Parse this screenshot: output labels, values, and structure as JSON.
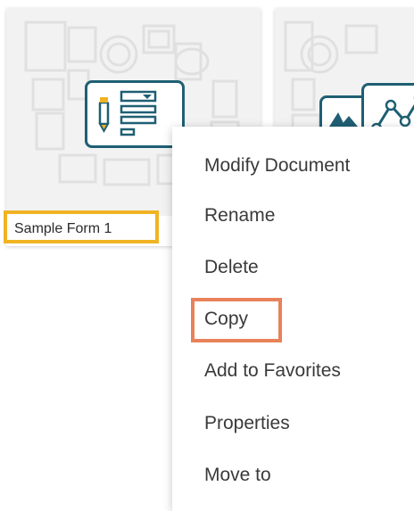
{
  "documents": [
    {
      "name": "Sample Form 1",
      "type": "form"
    },
    {
      "name": "",
      "type": "dashboard"
    }
  ],
  "context_menu": {
    "items": [
      {
        "label": "Modify Document"
      },
      {
        "label": "Rename"
      },
      {
        "label": "Delete"
      },
      {
        "label": "Copy"
      },
      {
        "label": "Add to Favorites"
      },
      {
        "label": "Properties"
      },
      {
        "label": "Move to"
      }
    ]
  },
  "colors": {
    "selection_highlight": "#f0b323",
    "copy_highlight": "#e8825a",
    "icon_stroke": "#1f5f73"
  }
}
